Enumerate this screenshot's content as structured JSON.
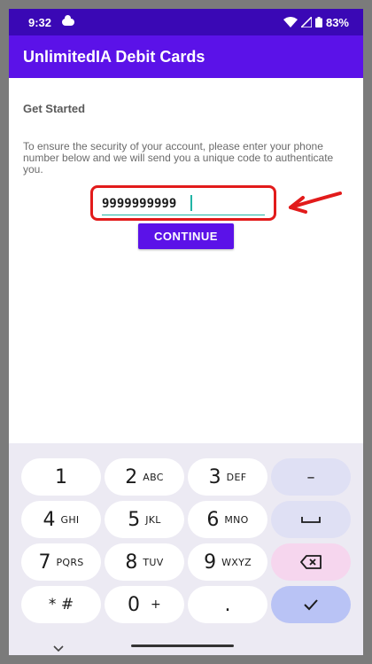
{
  "status_bar": {
    "time": "9:32",
    "battery": "83%"
  },
  "app_bar": {
    "title": "UnlimitedIA Debit Cards"
  },
  "main": {
    "heading": "Get Started",
    "description": "To ensure the security of your account, please enter your phone number below and we will send you a unique code to authenticate you.",
    "phone_value": "9999999999",
    "continue_label": "CONTINUE"
  },
  "colors": {
    "status_bar": "#3a08b5",
    "app_bar": "#5b12e8",
    "highlight": "#e21b1b",
    "underline": "#21b4a5"
  },
  "keyboard": {
    "k1": {
      "num": "1",
      "sub": ""
    },
    "k2": {
      "num": "2",
      "sub": "ABC"
    },
    "k3": {
      "num": "3",
      "sub": "DEF"
    },
    "k4": {
      "num": "4",
      "sub": "GHI"
    },
    "k5": {
      "num": "5",
      "sub": "JKL"
    },
    "k6": {
      "num": "6",
      "sub": "MNO"
    },
    "k7": {
      "num": "7",
      "sub": "PQRS"
    },
    "k8": {
      "num": "8",
      "sub": "TUV"
    },
    "k9": {
      "num": "9",
      "sub": "WXYZ"
    },
    "k0": {
      "num": "0",
      "sub": "+"
    },
    "star": "* #",
    "dot": ".",
    "dash": "–"
  }
}
